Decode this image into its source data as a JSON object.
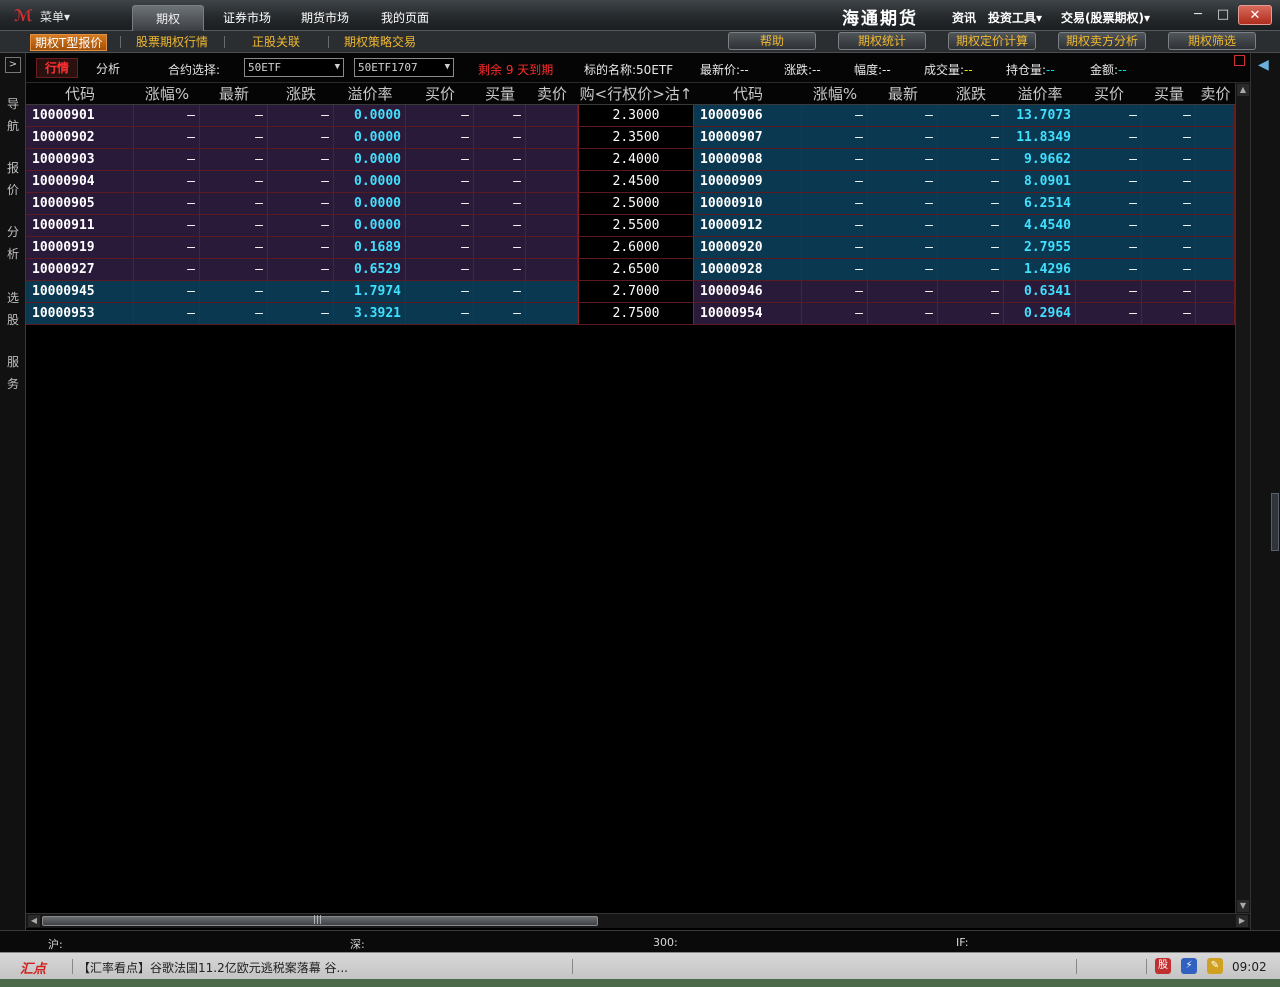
{
  "titlebar": {
    "menu_label": "菜单▾",
    "tabs": [
      "期权",
      "证券市场",
      "期货市场",
      "我的页面"
    ],
    "brand": "海通期货",
    "menus": [
      "资讯",
      "投资工具▾",
      "交易(股票期权)▾"
    ],
    "win_min": "─",
    "win_max": "□",
    "win_close": "✕"
  },
  "subbar": {
    "tabs": [
      "期权T型报价",
      "股票期权行情",
      "正股关联",
      "期权策略交易"
    ],
    "buttons": [
      "帮助",
      "期权统计",
      "期权定价计算",
      "期权卖方分析",
      "期权筛选"
    ]
  },
  "leftnav": {
    "toggle": ">",
    "items": [
      "导航",
      "报价",
      "分析",
      "选股",
      "服务"
    ]
  },
  "infobar": {
    "market_btn": "行情",
    "analysis_btn": "分析",
    "contract_label": "合约选择:",
    "underlying_value": "50ETF",
    "month_value": "50ETF1707",
    "remain_text": "剩余 9 天到期",
    "target_label": "标的名称:",
    "target_value": "50ETF",
    "last_label": "最新价:",
    "last_value": "--",
    "change_label": "涨跌:",
    "change_value": "--",
    "range_label": "幅度:",
    "range_value": "--",
    "volume_label": "成交量:",
    "volume_value": "--",
    "oi_label": "持仓量:",
    "oi_value": "--",
    "amount_label": "金额:",
    "amount_value": "--"
  },
  "table": {
    "call_headers": [
      "代码",
      "涨幅%",
      "最新",
      "涨跌",
      "溢价率",
      "买价",
      "买量",
      "卖价"
    ],
    "strike_header": "购<行权价>沽↑",
    "put_headers": [
      "代码",
      "涨幅%",
      "最新",
      "涨跌",
      "溢价率",
      "买价",
      "买量",
      "卖价"
    ],
    "dash": "–",
    "rows": [
      {
        "call_code": "10000901",
        "call_premium": "0.0000",
        "strike": "2.3000",
        "put_code": "10000906",
        "put_premium": "13.7073"
      },
      {
        "call_code": "10000902",
        "call_premium": "0.0000",
        "strike": "2.3500",
        "put_code": "10000907",
        "put_premium": "11.8349"
      },
      {
        "call_code": "10000903",
        "call_premium": "0.0000",
        "strike": "2.4000",
        "put_code": "10000908",
        "put_premium": "9.9662"
      },
      {
        "call_code": "10000904",
        "call_premium": "0.0000",
        "strike": "2.4500",
        "put_code": "10000909",
        "put_premium": "8.0901"
      },
      {
        "call_code": "10000905",
        "call_premium": "0.0000",
        "strike": "2.5000",
        "put_code": "10000910",
        "put_premium": "6.2514"
      },
      {
        "call_code": "10000911",
        "call_premium": "0.0000",
        "strike": "2.5500",
        "put_code": "10000912",
        "put_premium": "4.4540"
      },
      {
        "call_code": "10000919",
        "call_premium": "0.1689",
        "strike": "2.6000",
        "put_code": "10000920",
        "put_premium": "2.7955"
      },
      {
        "call_code": "10000927",
        "call_premium": "0.6529",
        "strike": "2.6500",
        "put_code": "10000928",
        "put_premium": "1.4296"
      },
      {
        "call_code": "10000945",
        "call_premium": "1.7974",
        "strike": "2.7000",
        "put_code": "10000946",
        "put_premium": "0.6341"
      },
      {
        "call_code": "10000953",
        "call_premium": "3.3921",
        "strike": "2.7500",
        "put_code": "10000954",
        "put_premium": "0.2964"
      }
    ]
  },
  "indexbar": {
    "sh": "沪:",
    "sz": "深:",
    "hs300": "300:",
    "if": "IF:"
  },
  "newsbar": {
    "badge": "汇点",
    "headline": "【汇率看点】谷歌法国11.2亿欧元逃税案落幕 谷...",
    "clock": "09:02"
  },
  "colors": {
    "in_money_bg": "#2a1a3a",
    "out_money_bg": "#0a3850",
    "premium_text": "#40e0ff",
    "remain_text": "#ff2a2a"
  }
}
